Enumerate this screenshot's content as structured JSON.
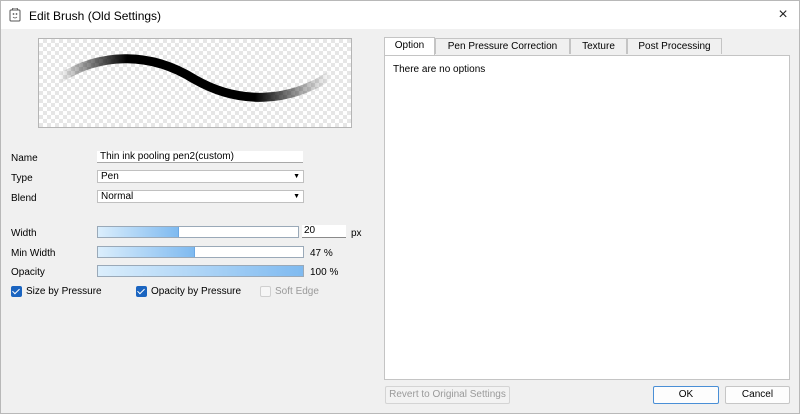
{
  "window": {
    "title": "Edit Brush (Old Settings)",
    "close_icon": "×"
  },
  "brush": {
    "name_label": "Name",
    "name_value": "Thin ink pooling pen2(custom)",
    "type_label": "Type",
    "type_value": "Pen",
    "blend_label": "Blend",
    "blend_value": "Normal",
    "dropdown_arrow": "▼"
  },
  "sliders": {
    "width": {
      "label": "Width",
      "value": "20",
      "unit": "px",
      "fill_fraction": 0.4
    },
    "min_width": {
      "label": "Min Width",
      "value": "47 %",
      "fill_fraction": 0.47
    },
    "opacity": {
      "label": "Opacity",
      "value": "100 %",
      "fill_fraction": 1.0
    }
  },
  "checkboxes": {
    "size_by_pressure": {
      "label": "Size by Pressure",
      "checked": true
    },
    "opacity_by_pressure": {
      "label": "Opacity by Pressure",
      "checked": true
    },
    "soft_edge": {
      "label": "Soft Edge",
      "checked": false
    }
  },
  "tabs": {
    "option": "Option",
    "pen_pressure": "Pen Pressure Correction",
    "texture": "Texture",
    "post_processing": "Post Processing",
    "active": "Option"
  },
  "panel": {
    "message": "There are no options"
  },
  "buttons": {
    "revert": "Revert to Original Settings",
    "ok": "OK",
    "cancel": "Cancel"
  },
  "colors": {
    "accent": "#1a64c0",
    "slider_fill": "#7fbaf0"
  }
}
